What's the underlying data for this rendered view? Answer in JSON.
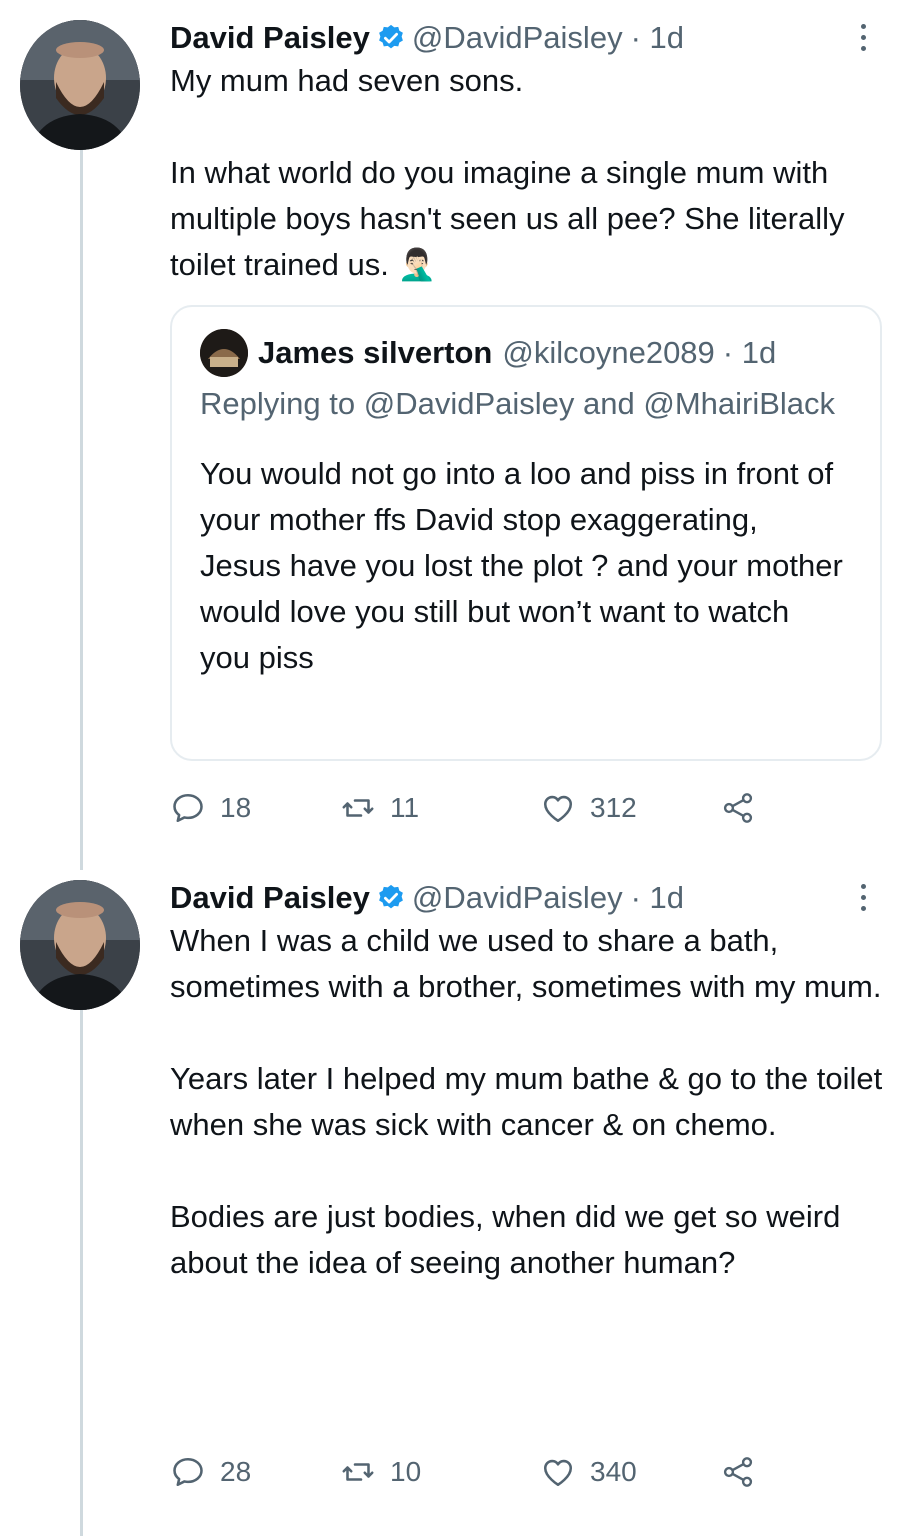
{
  "tweets": [
    {
      "name": "David Paisley",
      "handle": "@DavidPaisley",
      "time": "· 1d",
      "paragraphs": [
        "My mum had seven sons.",
        "In what world do you imagine a single mum with multiple boys hasn't seen us all pee? She literally toilet trained us. 🤦🏻‍♂️"
      ],
      "quote": {
        "name": "James silverton",
        "handle": "@kilcoyne2089",
        "time": "· 1d",
        "replying_prefix": "Replying to",
        "replying_to_1": "@DavidPaisley",
        "replying_and": "and",
        "replying_to_2": "@MhairiBlack",
        "text": "You would not go into a loo and piss in front of your mother ffs David stop exaggerating, Jesus have you lost the plot ? and your mother would love you still but won’t want to watch you piss"
      },
      "replies": "18",
      "retweets": "11",
      "likes": "312"
    },
    {
      "name": "David Paisley",
      "handle": "@DavidPaisley",
      "time": "· 1d",
      "paragraphs": [
        "When I was a child we used to share a bath, sometimes with a brother, sometimes with my mum.",
        "Years later I helped my mum bathe & go to the toilet when she was sick with cancer & on chemo.",
        "Bodies are just bodies, when did we get so weird about the idea of seeing another human?"
      ],
      "replies": "28",
      "retweets": "10",
      "likes": "340"
    }
  ],
  "icons": {
    "verified": "verified-badge-icon",
    "reply": "reply-icon",
    "retweet": "retweet-icon",
    "like": "heart-icon",
    "share": "share-icon",
    "more": "more-icon"
  },
  "colors": {
    "text": "#0f1419",
    "secondary": "#536471",
    "verified": "#1d9bf0",
    "border": "#e6ecf0"
  }
}
